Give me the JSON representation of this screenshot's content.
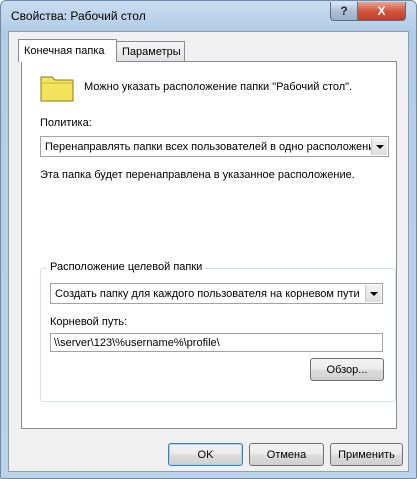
{
  "window": {
    "title": "Свойства: Рабочий стол",
    "help_glyph": "?",
    "close_glyph": "X"
  },
  "tabs": [
    {
      "label": "Конечная папка",
      "active": true
    },
    {
      "label": "Параметры",
      "active": false
    }
  ],
  "target_tab": {
    "description": "Можно указать расположение папки \"Рабочий стол\".",
    "policy_label": "Политика:",
    "policy_value": "Перенаправлять папки всех пользователей в одно расположение",
    "policy_note": "Эта папка будет перенаправлена в указанное расположение.",
    "group_title": "Расположение целевой папки",
    "location_value": "Создать папку для каждого пользователя на корневом пути",
    "root_path_label": "Корневой путь:",
    "root_path_value": "\\\\server\\123\\%username%\\profile\\",
    "browse_label": "Обзор..."
  },
  "buttons": {
    "ok": "OK",
    "cancel": "Отмена",
    "apply": "Применить"
  },
  "colors": {
    "title_gradient_top": "#c9dcf0",
    "close_red": "#c13d24",
    "folder_yellow": "#f2e35a"
  },
  "icons": {
    "folder": "folder-icon",
    "help": "help-icon",
    "close": "close-icon",
    "dropdown": "chevron-down-icon"
  }
}
